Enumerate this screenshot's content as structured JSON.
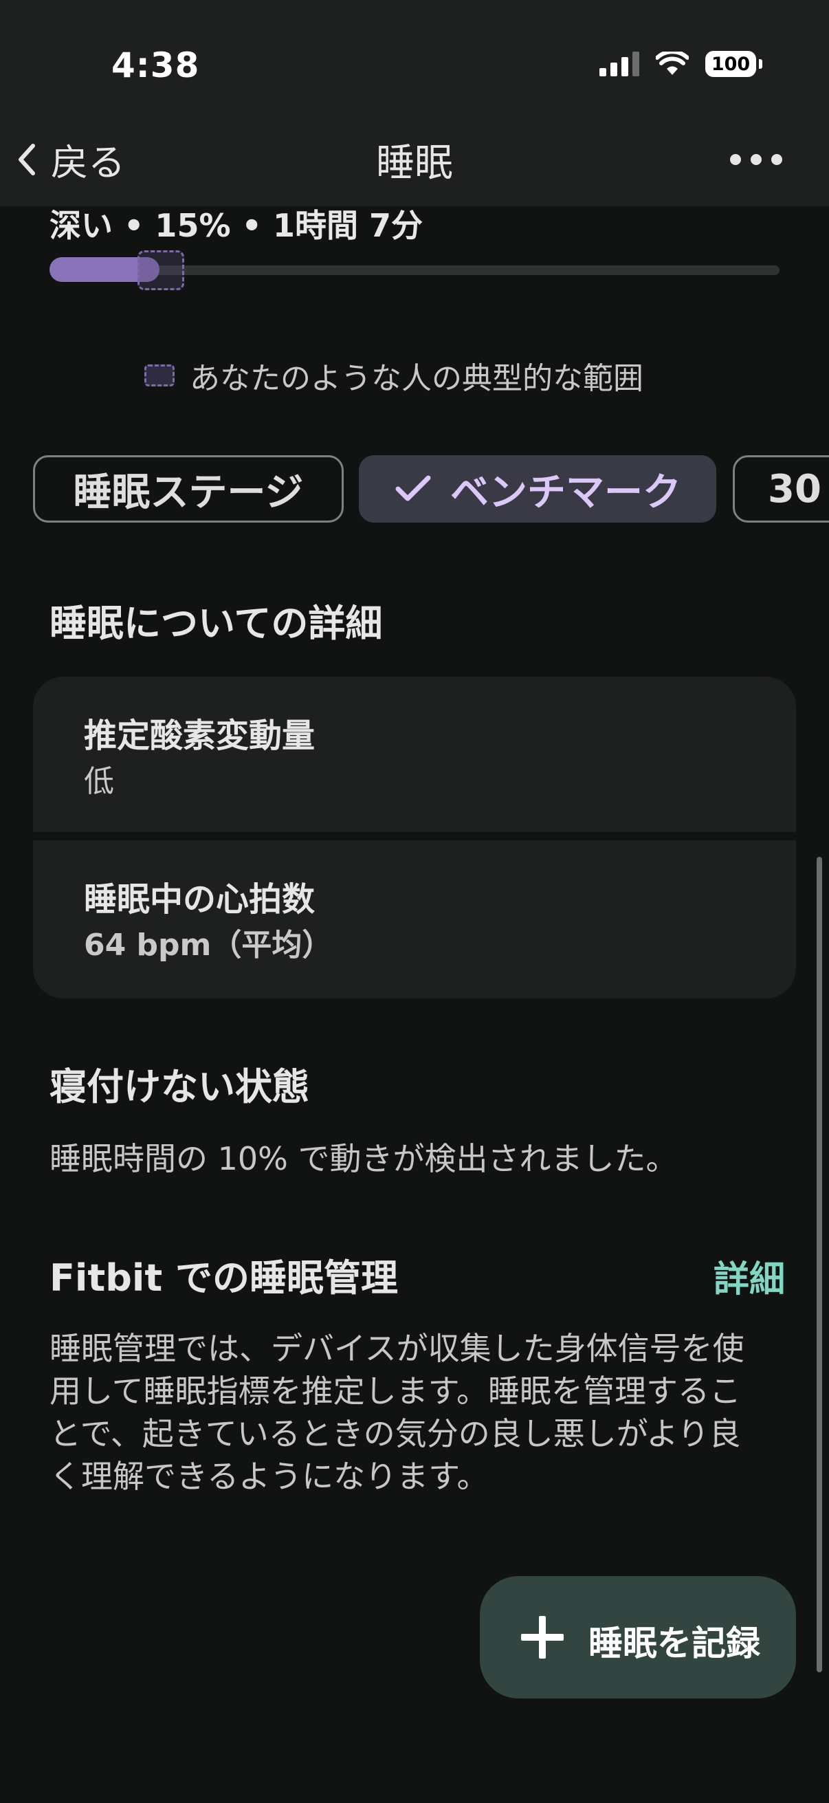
{
  "status_bar": {
    "time": "4:38",
    "battery": "100"
  },
  "nav": {
    "back_label": "戻る",
    "title": "睡眠"
  },
  "deep_sleep": {
    "label": "深い • 15% • 1時間 7分",
    "progress_percent": 15,
    "fill_color": "#8a72b8"
  },
  "legend": {
    "label": "あなたのような人の典型的な範囲"
  },
  "chips": [
    {
      "label": "睡眠ステージ",
      "selected": false
    },
    {
      "label": "ベンチマーク",
      "selected": true
    },
    {
      "label": "30",
      "selected": false
    }
  ],
  "details_section": {
    "title": "睡眠についての詳細",
    "cards": [
      {
        "label": "推定酸素変動量",
        "value": "低"
      },
      {
        "label": "睡眠中の心拍数",
        "value": "64 bpm（平均）"
      }
    ]
  },
  "restless_section": {
    "title": "寝付けない状態",
    "text": "睡眠時間の 10% で動きが検出されました。"
  },
  "tracking_section": {
    "title": "Fitbit での睡眠管理",
    "link": "詳細",
    "lines": [
      "睡眠管理では、デバイスが収集した身体信号を使",
      "用して睡眠指標を推定します。睡眠を管理するこ",
      "とで、起きているときの気分の良し悪しがより良",
      "く理解できるようになります。"
    ],
    "link_color": "#7fd7c4"
  },
  "fab": {
    "label": "睡眠を記録"
  }
}
